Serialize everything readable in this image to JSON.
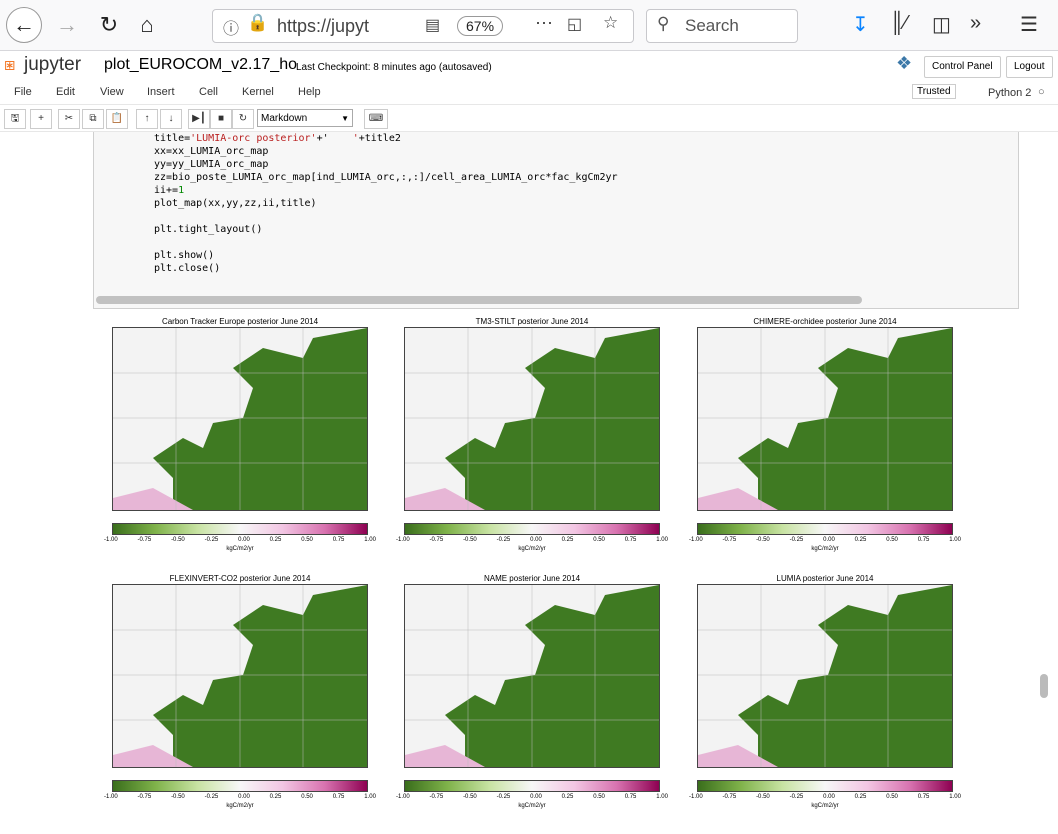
{
  "browser": {
    "url": "https://jupyt",
    "zoom": "67%",
    "search_placeholder": "Search"
  },
  "jupyter": {
    "logo_text": "jupyter",
    "notebook_name": "plot_EUROCOM_v2.17_ho",
    "checkpoint": "Last Checkpoint: 8 minutes ago (autosaved)",
    "control_panel": "Control Panel",
    "logout": "Logout",
    "trusted": "Trusted",
    "kernel": "Python 2"
  },
  "menu": [
    "File",
    "Edit",
    "View",
    "Insert",
    "Cell",
    "Kernel",
    "Help"
  ],
  "toolbar": {
    "cell_type": "Markdown"
  },
  "code": {
    "line1_a": "title=",
    "line1_str1": "'LUMIA-orc posterior'",
    "line1_b": "+'",
    "line1_str2": "    '",
    "line1_c": "+title2",
    "line2": "xx=xx_LUMIA_orc_map",
    "line3": "yy=yy_LUMIA_orc_map",
    "line4": "zz=bio_poste_LUMIA_orc_map[ind_LUMIA_orc,:,:]/cell_area_LUMIA_orc*fac_kgCm2yr",
    "line5_a": "ii+=",
    "line5_num": "1",
    "line6": "plot_map(xx,yy,zz,ii,title)",
    "line7": "plt.tight_layout()",
    "line8": "plt.show()",
    "line9": "plt.close()"
  },
  "maps": {
    "ticks": [
      "-1.00",
      "-0.75",
      "-0.50",
      "-0.25",
      "0.00",
      "0.25",
      "0.50",
      "0.75",
      "1.00"
    ],
    "unit": "kgC/m2/yr",
    "panels": [
      {
        "title": "Carbon Tracker Europe posterior   June 2014"
      },
      {
        "title": "TM3-STILT posterior   June 2014"
      },
      {
        "title": "CHIMERE-orchidee posterior   June 2014"
      },
      {
        "title": "FLEXINVERT-CO2 posterior   June 2014"
      },
      {
        "title": "NAME posterior   June 2014"
      },
      {
        "title": "LUMIA posterior   June 2014"
      }
    ]
  }
}
